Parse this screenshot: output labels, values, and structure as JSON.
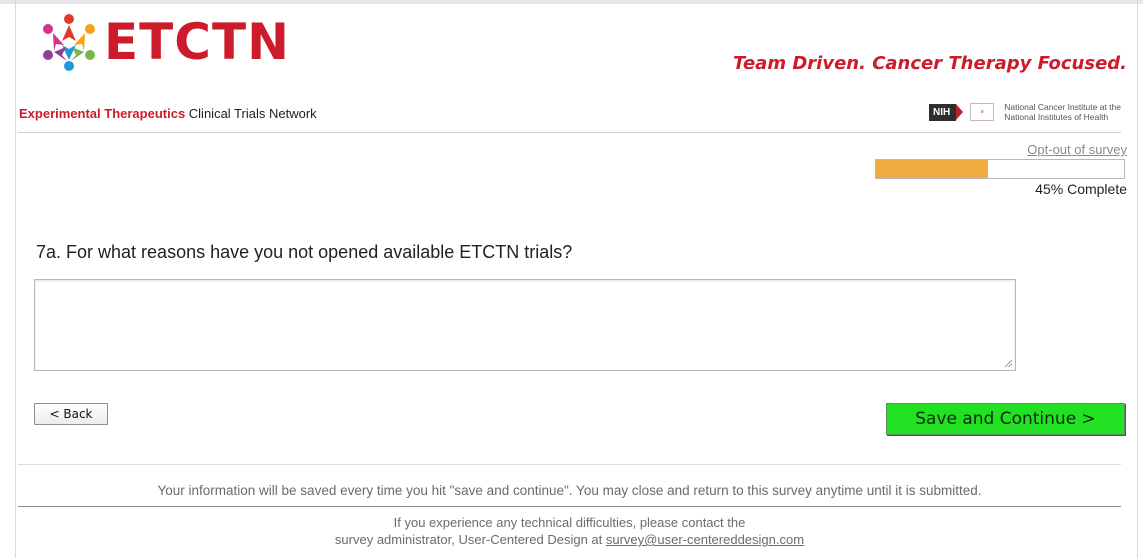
{
  "header": {
    "logo_text": "ETCTN",
    "tagline": "Team Driven. Cancer Therapy Focused.",
    "network_name_strong": "Experimental Therapeutics",
    "network_name_rest": " Clinical Trials Network",
    "nih_badge": "NIH",
    "nci_line1": "National Cancer Institute at the",
    "nci_line2": "National Institutes of Health"
  },
  "progress": {
    "optout_label": "Opt-out of survey",
    "percent": 45,
    "label": "45% Complete",
    "fill_color": "#f0ab40"
  },
  "question": {
    "text": "7a. For what reasons have you not opened available ETCTN trials?",
    "answer_value": ""
  },
  "nav": {
    "back_label": "< Back",
    "save_label": "Save and Continue >",
    "save_color": "#22e122"
  },
  "footer": {
    "note": "Your information will be saved every time you hit \"save and continue\". You may close and return to this survey anytime until it is submitted.",
    "contact_line1": "If you experience any technical difficulties, please contact the",
    "contact_line2_prefix": "survey administrator, User-Centered Design at ",
    "contact_email": "survey@user-centereddesign.com"
  },
  "brand_color": "#cc1c2c"
}
